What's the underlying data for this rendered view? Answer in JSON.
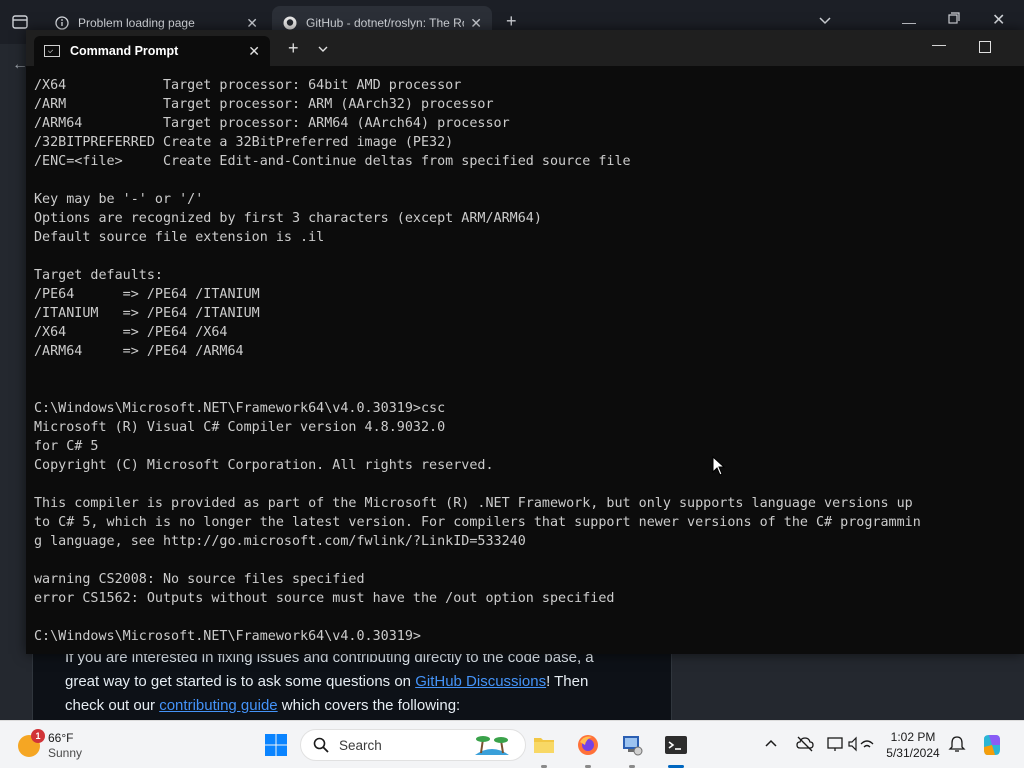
{
  "browser": {
    "tabs": [
      {
        "title": "Problem loading page"
      },
      {
        "title": "GitHub - dotnet/roslyn: The Ro"
      }
    ],
    "article": {
      "line1": "If you are interested in fixing issues and contributing directly to the code base, a",
      "line2_pre": "great way to get started is to ask some questions on ",
      "line2_link": "GitHub Discussions",
      "line2_post": "! Then",
      "line3_pre": "check out our ",
      "line3_link": "contributing guide",
      "line3_post": " which covers the following:"
    }
  },
  "terminal": {
    "tab_title": "Command Prompt",
    "lines": [
      "/X64            Target processor: 64bit AMD processor",
      "/ARM            Target processor: ARM (AArch32) processor",
      "/ARM64          Target processor: ARM64 (AArch64) processor",
      "/32BITPREFERRED Create a 32BitPreferred image (PE32)",
      "/ENC=<file>     Create Edit-and-Continue deltas from specified source file",
      "",
      "Key may be '-' or '/'",
      "Options are recognized by first 3 characters (except ARM/ARM64)",
      "Default source file extension is .il",
      "",
      "Target defaults:",
      "/PE64      => /PE64 /ITANIUM",
      "/ITANIUM   => /PE64 /ITANIUM",
      "/X64       => /PE64 /X64",
      "/ARM64     => /PE64 /ARM64",
      "",
      "",
      "C:\\Windows\\Microsoft.NET\\Framework64\\v4.0.30319>csc",
      "Microsoft (R) Visual C# Compiler version 4.8.9032.0",
      "for C# 5",
      "Copyright (C) Microsoft Corporation. All rights reserved.",
      "",
      "This compiler is provided as part of the Microsoft (R) .NET Framework, but only supports language versions up",
      "to C# 5, which is no longer the latest version. For compilers that support newer versions of the C# programmin",
      "g language, see http://go.microsoft.com/fwlink/?LinkID=533240",
      "",
      "warning CS2008: No source files specified",
      "error CS1562: Outputs without source must have the /out option specified",
      "",
      "C:\\Windows\\Microsoft.NET\\Framework64\\v4.0.30319>"
    ]
  },
  "taskbar": {
    "weather": {
      "temp": "66°F",
      "condition": "Sunny",
      "badge": "1"
    },
    "search_label": "Search",
    "time": "1:02 PM",
    "date": "5/31/2024"
  },
  "icons": {
    "browser_tab1": "firefox-warning-icon",
    "browser_tab2": "github-icon",
    "terminal_tab": "cmd-icon",
    "taskbar": [
      "windows-start-icon",
      "search-icon",
      "file-explorer-icon",
      "firefox-icon",
      "app-icon",
      "terminal-icon"
    ],
    "tray": [
      "chevron-up-icon",
      "cloud-offline-icon",
      "display-icon",
      "speaker-icon",
      "network-icon",
      "bell-icon",
      "copilot-icon"
    ]
  },
  "colors": {
    "terminal_bg": "#0c0c0c",
    "terminal_text": "#cccccc",
    "link": "#4493f8",
    "taskbar_accent": "#0067c0"
  }
}
